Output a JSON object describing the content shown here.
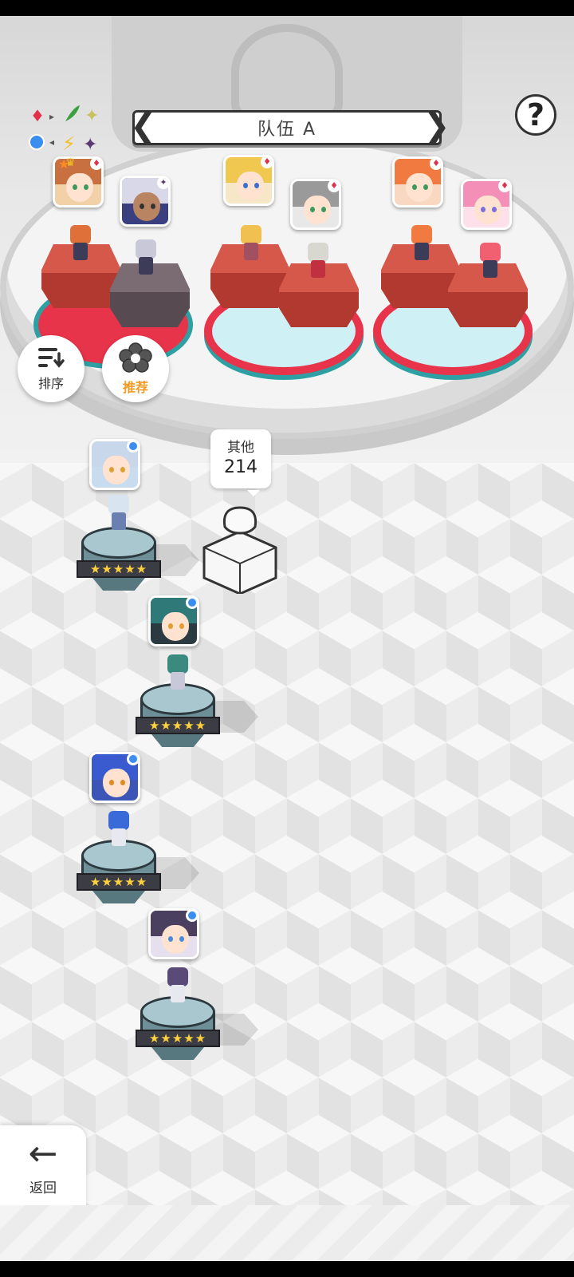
{
  "header": {
    "team_title": "队伍 A",
    "prev_symbol": "❮",
    "next_symbol": "❯",
    "help_symbol": "?"
  },
  "side_buttons": {
    "sort_label": "排序",
    "recommend_label": "推荐"
  },
  "bench_bubble": {
    "label": "其他",
    "count": "214"
  },
  "footer": {
    "back_label": "返回",
    "back_symbol": "←"
  },
  "star_text": "★★★★★",
  "colors": {
    "accent_red": "#e8344a",
    "accent_teal": "#2ea0a3",
    "recommend_orange": "#f29a24",
    "status_blue": "#3a8ef0"
  },
  "icons": [
    "sort-icon",
    "recommend-flower-icon",
    "help-icon",
    "back-arrow-icon",
    "synergy-icon"
  ]
}
